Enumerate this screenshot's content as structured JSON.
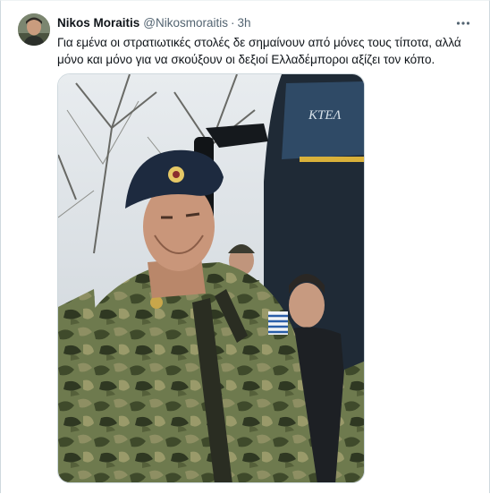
{
  "tweet": {
    "author_name": "Nikos Moraitis",
    "author_handle": "@Nikosmoraitis",
    "separator": "·",
    "time": "3h",
    "text": "Για εμένα οι στρατιωτικές στολές δε σημαίνουν από μόνες τους τίποτα, αλλά μόνο και μόνο για να σκούξουν οι δεξιοί Ελλαδέμποροι αξίζει τον κόπο.",
    "more_icon": "more-horizontal-icon",
    "avatar_icon": "profile-photo",
    "media": {
      "bus_sign": "ΚΤΕΛ"
    }
  },
  "colors": {
    "text_primary": "#0f1419",
    "text_secondary": "#536471",
    "border": "#cfd9de"
  }
}
